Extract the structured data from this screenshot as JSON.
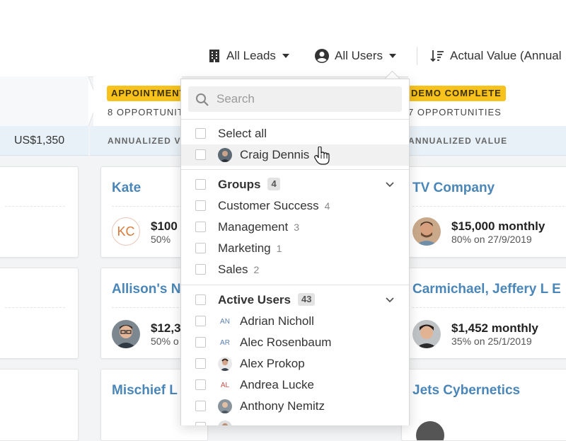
{
  "toolbar": {
    "leads_filter": "All Leads",
    "users_filter": "All Users",
    "sort_label": "Actual Value (Annual"
  },
  "board": {
    "total_value": "US$1,350",
    "annualized_label": "ANNUALIZED VALUE",
    "annualized_label_cut": "ANNUALIZED V",
    "columns": [
      {
        "badge": "APPOINTMENT",
        "opportunities": "8 OPPORTUNITIES"
      },
      {
        "badge": "DEMO COMPLETE",
        "opportunities": "7 OPPORTUNITIES"
      }
    ],
    "cards_mid": [
      {
        "title": "Kate",
        "amount": "$100",
        "sub": "50%",
        "initials": "KC"
      },
      {
        "title": "Allison's N",
        "amount": "$12,3",
        "sub": "50% o"
      },
      {
        "title": "Mischief L"
      }
    ],
    "cards_right": [
      {
        "title": "TV Company",
        "amount": "$15,000 monthly",
        "sub": "80% on 27/9/2019"
      },
      {
        "title": "Carmichael, Jeffery L E",
        "amount": "$1,452 monthly",
        "sub": "35% on 25/1/2019"
      },
      {
        "title": "Jets Cybernetics"
      }
    ]
  },
  "dropdown": {
    "search_placeholder": "Search",
    "select_all": "Select all",
    "current_user": "Craig Dennis",
    "groups": {
      "label": "Groups",
      "count": "4",
      "items": [
        {
          "name": "Customer Success",
          "count": "4"
        },
        {
          "name": "Management",
          "count": "3"
        },
        {
          "name": "Marketing",
          "count": "1"
        },
        {
          "name": "Sales",
          "count": "2"
        }
      ]
    },
    "active_users": {
      "label": "Active Users",
      "count": "43",
      "items": [
        {
          "name": "Adrian Nicholl",
          "initials": "AN"
        },
        {
          "name": "Alec Rosenbaum",
          "initials": "AR"
        },
        {
          "name": "Alex Prokop"
        },
        {
          "name": "Andrea Lucke",
          "initials": "AL"
        },
        {
          "name": "Anthony Nemitz"
        }
      ]
    }
  },
  "colors": {
    "badge": "#f7c21b",
    "link": "#4a86b8",
    "value_row": "#e8f1f7"
  }
}
